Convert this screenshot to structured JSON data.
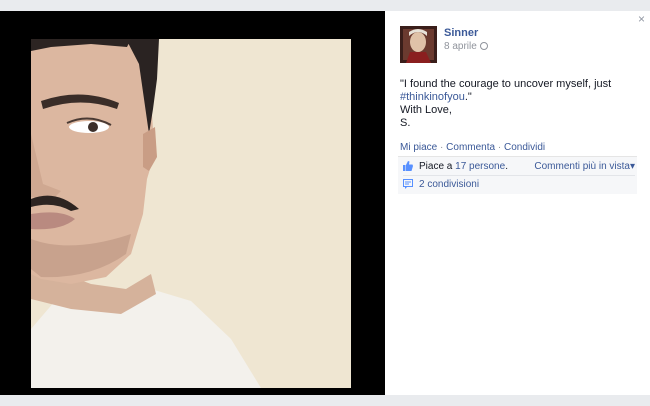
{
  "photo": {
    "subject": "selfie"
  },
  "close_label": "×",
  "author": {
    "name": "Sinner",
    "date": "8 aprile"
  },
  "post": {
    "line1": "\"I found the courage to uncover myself, just",
    "hashtag": "#thinkinofyou",
    "hashtag_suffix": ".\"",
    "line3": "With Love,",
    "line4": "S."
  },
  "actions": {
    "like": "Mi piace",
    "comment": "Commenta",
    "share": "Condividi",
    "separator": "·"
  },
  "likes": {
    "prefix": "Piace a",
    "count": "17 persone",
    "suffix": ".",
    "sort_label": "Commenti più in vista",
    "sort_caret": "▾"
  },
  "shares": {
    "label": "2 condivisioni"
  },
  "icons": {
    "close": "close-icon",
    "globe": "globe-icon",
    "thumb": "thumbs-up-icon",
    "share": "share-icon"
  }
}
